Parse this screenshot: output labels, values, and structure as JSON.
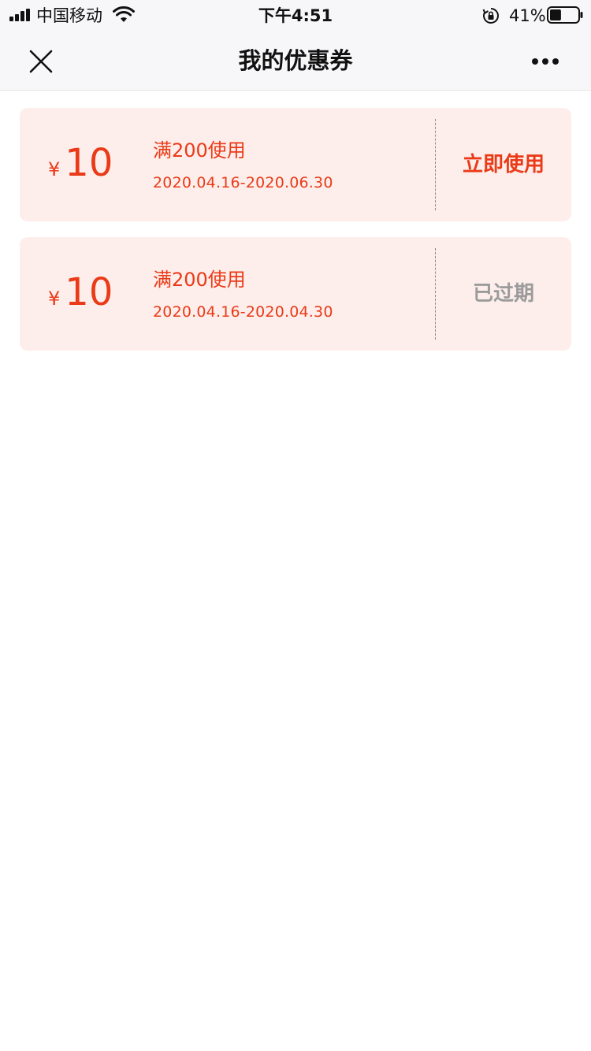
{
  "status_bar": {
    "carrier": "中国移动",
    "time": "下午4:51",
    "battery_percent": "41%",
    "battery_level": 0.41,
    "icons": [
      "signal-icon",
      "wifi-icon",
      "rotation-lock-icon",
      "battery-icon"
    ]
  },
  "nav": {
    "title": "我的优惠券",
    "close_icon": "close-icon",
    "more_icon": "more-icon"
  },
  "coupons": [
    {
      "currency": "¥",
      "amount": "10",
      "condition": "满200使用",
      "validity": "2020.04.16-2020.06.30",
      "action": "立即使用",
      "status": "active"
    },
    {
      "currency": "¥",
      "amount": "10",
      "condition": "满200使用",
      "validity": "2020.04.16-2020.04.30",
      "action": "已过期",
      "status": "expired"
    }
  ],
  "colors": {
    "accent": "#ea3a17",
    "coupon_bg": "#fdeeeb",
    "expired_text": "#9b9b9b",
    "bar_bg": "#f7f7f9"
  }
}
